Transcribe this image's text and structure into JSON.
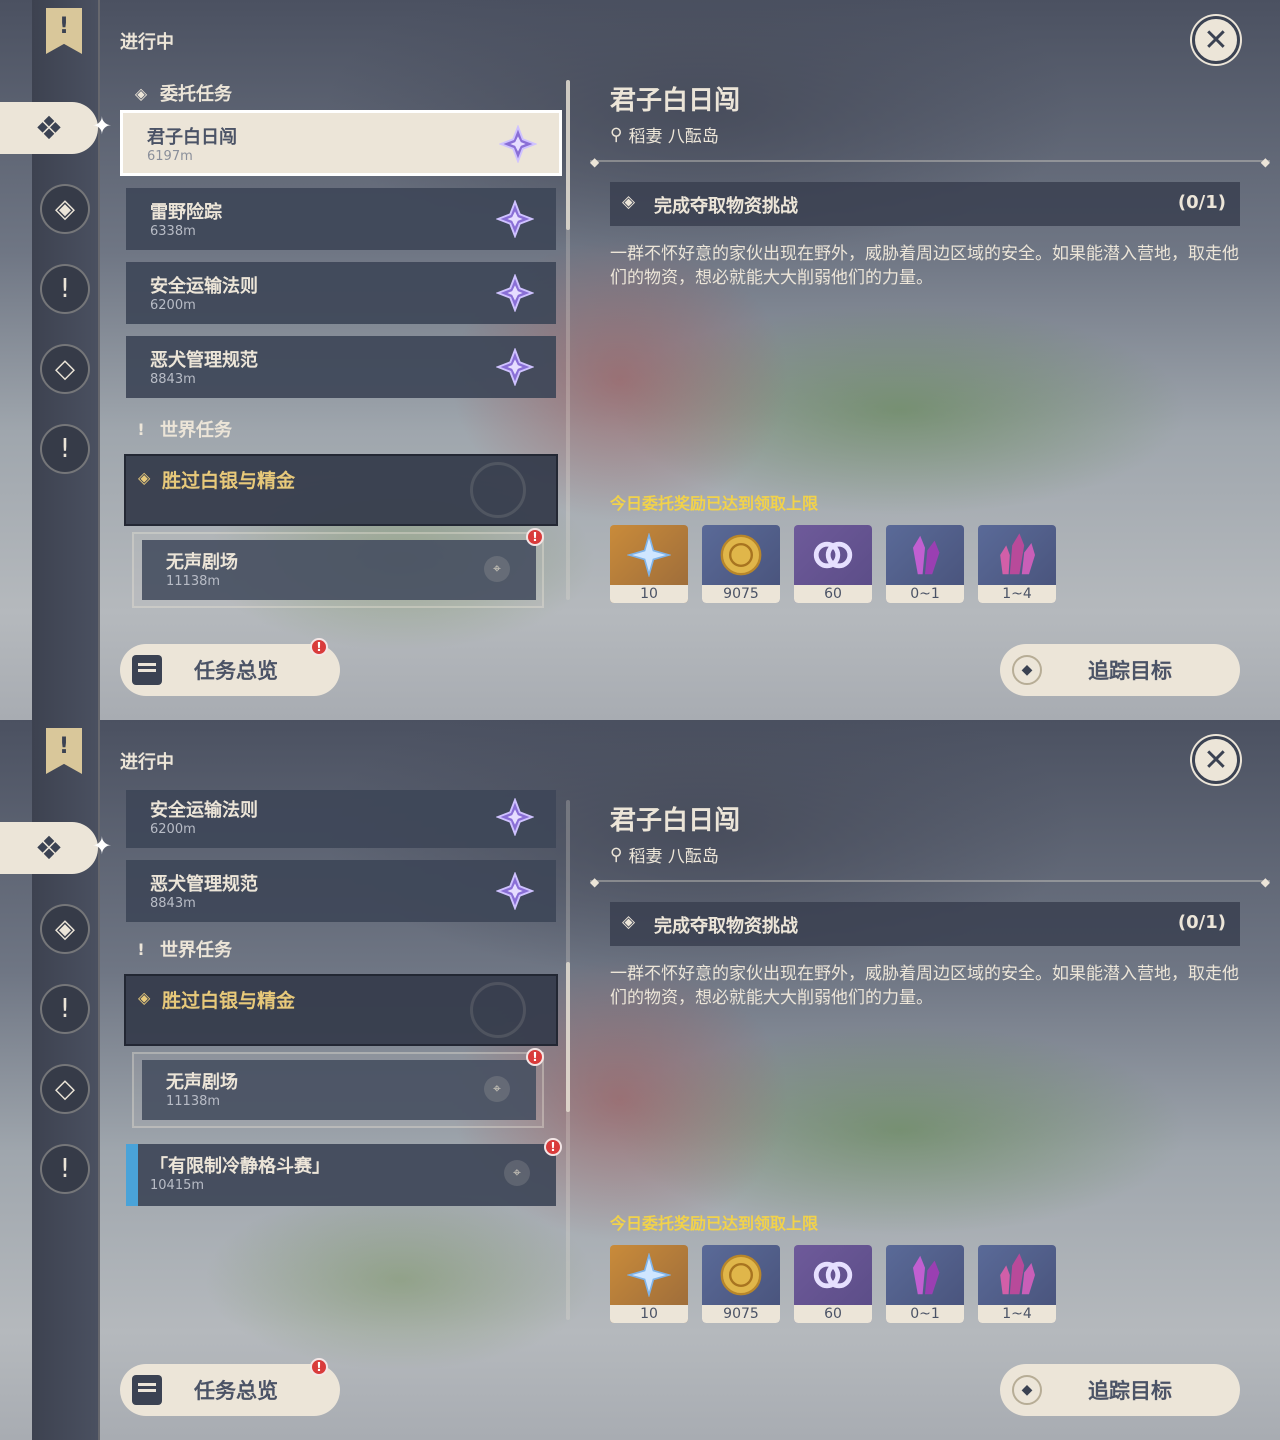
{
  "header": {
    "section_label": "进行中",
    "close_label": "✕"
  },
  "categories": {
    "commission": "委托任务",
    "world": "世界任务"
  },
  "commissions": [
    {
      "name": "君子白日闯",
      "distance": "6197m"
    },
    {
      "name": "雷野险踪",
      "distance": "6338m"
    },
    {
      "name": "安全运输法则",
      "distance": "6200m"
    },
    {
      "name": "恶犬管理规范",
      "distance": "8843m"
    }
  ],
  "world_quest": {
    "title": "胜过白银与精金",
    "sub": {
      "name": "无声剧场",
      "distance": "11138m",
      "alert": "!"
    }
  },
  "event_quest": {
    "name": "「有限制冷静格斗赛」",
    "distance": "10415m",
    "alert": "!"
  },
  "detail": {
    "title": "君子白日闯",
    "location": "稻妻 八酝岛",
    "objective": {
      "text": "完成夺取物资挑战",
      "progress": "(0/1)"
    },
    "description": "一群不怀好意的家伙出现在野外，威胁着周边区域的安全。如果能潜入营地，取走他们的物资，想必就能大大削弱他们的力量。",
    "reward_note": "今日委托奖励已达到领取上限",
    "rewards": [
      {
        "icon": "primogem-icon",
        "count": "10"
      },
      {
        "icon": "mora-icon",
        "count": "9075"
      },
      {
        "icon": "companionship-exp-icon",
        "count": "60"
      },
      {
        "icon": "crystal-icon",
        "count": "0~1"
      },
      {
        "icon": "crystal-cluster-icon",
        "count": "1~4"
      }
    ]
  },
  "buttons": {
    "overview": "任务总览",
    "overview_alert": "!",
    "track": "追踪目标"
  },
  "colors": {
    "accent": "#ece5d8",
    "gold_text": "#e8c97a",
    "reward_note": "#f2d24a",
    "alert": "#d93b3b",
    "event_bar": "#4aa3d9"
  }
}
